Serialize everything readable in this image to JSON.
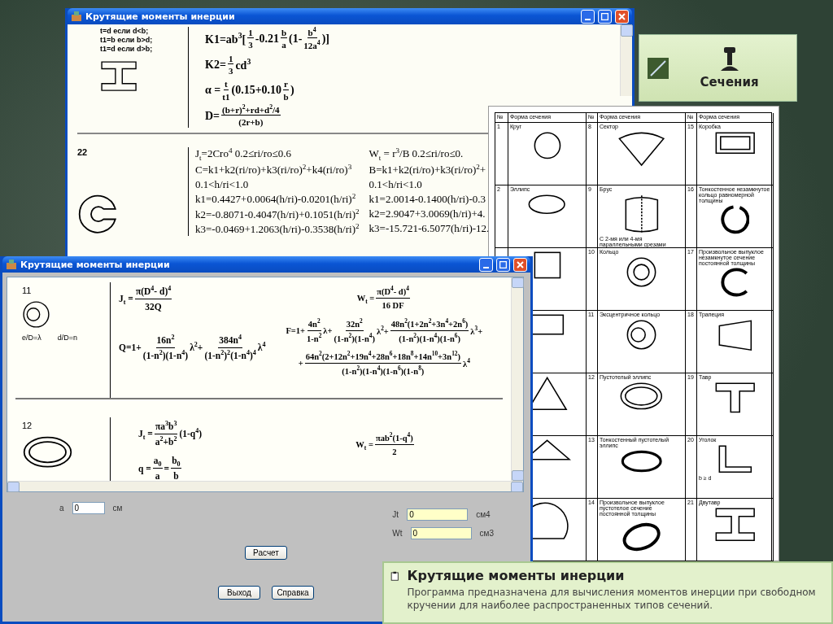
{
  "back_window": {
    "title": "Крутящие моменты инерции",
    "top_section": {
      "notes": [
        "t=d если d<b;",
        "t1=b если b>d;",
        "t1=d если d>b;"
      ],
      "kind": "i_beam",
      "formulas": [
        [
          "K1=ab$^{3}$[",
          {
            "num": "1",
            "den": "3"
          },
          "-0.21",
          {
            "num": "b",
            "den": "a"
          },
          "(1-",
          {
            "num": "b$^{4}$",
            "den": "12a$^{4}$"
          },
          ")]"
        ],
        [
          "K2=",
          {
            "num": "1",
            "den": "3"
          },
          "cd$^{3}$"
        ],
        [
          "α =",
          {
            "num": "t",
            "den": "t1"
          },
          "(0.15+0.10",
          {
            "num": "r",
            "den": "b"
          },
          ")"
        ],
        [
          "D=",
          {
            "num": "(b+r)$^{2}$+rd+d$^{2}$/4",
            "den": "(2r+b)"
          }
        ]
      ]
    },
    "second_section": {
      "number": "22",
      "kind": "split_ring",
      "left_lines": [
        "J$_{t}$=2Cro$^{4}$  0.2≤ri/ro≤0.6",
        "C=k1+k2(ri/ro)+k3(ri/ro)$^{2}$+k4(ri/ro)$^{3}$",
        "0.1<h/ri<1.0",
        "k1=0.4427+0.0064(h/ri)-0.0201(h/ri)$^{2}$",
        "k2=-0.8071-0.4047(h/ri)+0.1051(h/ri)$^{2}$",
        "k3=-0.0469+1.2063(h/ri)-0.3538(h/ri)$^{2}$"
      ],
      "right_lines": [
        "W$_{t}$ = r$^{3}$/B   0.2≤ri/ro≤0.",
        "B=k1+k2(ri/ro)+k3(ri/ro)$^{2}$+",
        "0.1<h/ri<1.0",
        "k1=2.0014-0.1400(h/ri)-0.3",
        "k2=2.9047+3.0069(h/ri)+4.",
        "k3=-15.721-6.5077(h/ri)-12."
      ]
    }
  },
  "section_table": {
    "headers": [
      "№",
      "Форма сечения",
      "№",
      "Форма сечения",
      "№",
      "Форма сечения"
    ],
    "rows": [
      [
        {
          "number": "1",
          "name": "Круг",
          "kind": "circle"
        },
        {
          "number": "8",
          "name": "Сектор",
          "kind": "sector"
        },
        {
          "number": "15",
          "name": "Коробка",
          "kind": "box"
        }
      ],
      [
        {
          "number": "2",
          "name": "Эллипс",
          "kind": "ellipse"
        },
        {
          "number": "9",
          "name": "Брус",
          "kind": "bar",
          "note": "С 2-мя или 4-мя параллельными срезами"
        },
        {
          "number": "16",
          "name": "Тонкостенное незамкнутое кольцо равномерной толщины",
          "kind": "thin_split_ring"
        }
      ],
      [
        {
          "kind": "square"
        },
        {
          "number": "10",
          "name": "Кольцо",
          "kind": "ring"
        },
        {
          "number": "17",
          "name": "Произвольное выпуклое незамкнутое сечение постоянной толщины",
          "kind": "open_shape"
        }
      ],
      [
        {
          "kind": "rectangle"
        },
        {
          "number": "11",
          "name": "Эксцентричное кольцо",
          "kind": "eccentric_ring"
        },
        {
          "number": "18",
          "name": "Трапеция",
          "kind": "trapezoid"
        }
      ],
      [
        {
          "kind": "triangle"
        },
        {
          "number": "12",
          "name": "Пустотелый эллипс",
          "kind": "hollow_ellipse"
        },
        {
          "number": "19",
          "name": "Тавр",
          "kind": "tee"
        }
      ],
      [
        {
          "kind": "isosceles_triangle"
        },
        {
          "number": "13",
          "name": "Тонкостенный пустотелый эллипс",
          "kind": "thin_ellipse"
        },
        {
          "number": "20",
          "name": "Уголок",
          "kind": "angle",
          "note": "b ≥ d"
        }
      ],
      [
        {
          "kind": "segment"
        },
        {
          "number": "14",
          "name": "Произвольное выпуклое пустотелое сечение постоянной толщины",
          "kind": "hollow_shape"
        },
        {
          "number": "21",
          "name": "Двутавр",
          "kind": "i_beam"
        }
      ]
    ]
  },
  "front_window": {
    "title": "Крутящие моменты инерции",
    "sections": [
      {
        "number": "11",
        "kind": "eccentric_ring",
        "notes": [
          "e/D=λ",
          "d/D=n"
        ],
        "left_formulas": [
          [
            "J$_{t}$ =",
            {
              "num": "π(D$^{4}$- d)$^{4}$",
              "den": "32Q"
            }
          ],
          [
            "Q=1+",
            {
              "num": "16n$^{2}$",
              "den": "(1-n$^{2}$)(1-n$^{4}$)"
            },
            "λ$^{2}$+",
            {
              "num": "384n$^{4}$",
              "den": "(1-n$^{2}$)$^{2}$(1-n$^{4}$)$^{4}$"
            },
            "λ$^{4}$"
          ]
        ],
        "right_formulas": [
          [
            "W$_{t}$ =",
            {
              "num": "π(D$^{4}$- d)$^{4}$",
              "den": "16 DF"
            }
          ],
          [
            "F=1+",
            {
              "num": "4n$^{2}$",
              "den": "1-n$^{2}$"
            },
            "λ+",
            {
              "num": "32n$^{2}$",
              "den": "(1-n$^{2}$)(1-n$^{4}$)"
            },
            "λ$^{2}$+",
            {
              "num": "48n$^{2}$(1+2n$^{2}$+3n$^{4}$+2n$^{6}$)",
              "den": "(1-n$^{2}$)(1-n$^{4}$)(1-n$^{6}$)"
            },
            "λ$^{3}$+"
          ],
          [
            "+",
            {
              "num": "64n$^{2}$(2+12n$^{2}$+19n$^{4}$+28n$^{6}$+18n$^{8}$+14n$^{10}$+3n$^{12}$)",
              "den": "(1-n$^{2}$)(1-n$^{4}$)(1-n$^{6}$)(1-n$^{8}$)"
            },
            "λ$^{4}$"
          ]
        ]
      },
      {
        "number": "12",
        "kind": "hollow_ellipse",
        "left_formulas": [
          [
            "J$_{t}$ =",
            {
              "num": "πa$^{3}$b$^{3}$",
              "den": "a$^{2}$+b$^{2}$"
            },
            "(1-q$^{4}$)"
          ],
          [
            "q =",
            {
              "num": "a$_{0}$",
              "den": "a"
            },
            "=",
            {
              "num": "b$_{0}$",
              "den": "b"
            }
          ]
        ],
        "right_formulas": [
          [
            "W$_{t}$ =",
            {
              "num": "πab$^{2}$(1-q$^{4}$)",
              "den": "2"
            }
          ]
        ]
      }
    ],
    "inputs": [
      {
        "label": "a",
        "value": "0",
        "unit": "см"
      }
    ],
    "outputs": [
      {
        "label": "Jt",
        "value": "0",
        "unit": "см4"
      },
      {
        "label": "Wt",
        "value": "0",
        "unit": "см3"
      }
    ],
    "calc_button": "Расчет",
    "buttons": [
      "Выход",
      "Справка"
    ]
  },
  "sections_tile": {
    "label": "Сечения"
  },
  "info_banner": {
    "title": "Крутящие моменты инерции",
    "text": "Программа предназначена для вычисления моментов инерции при свободном кручении для наиболее распространенных типов сечений."
  }
}
